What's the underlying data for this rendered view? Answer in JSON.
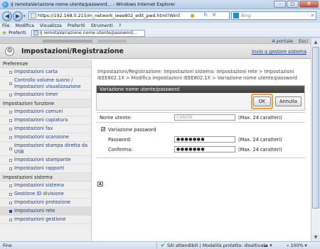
{
  "window": {
    "title": "IJ remotaVariazione nome utente/password… - Windows Internet Explorer",
    "btn_min": "–",
    "btn_max": "□",
    "btn_close": "X"
  },
  "addressbar": {
    "back": "◀",
    "forward": "▶",
    "dropdown": "▾",
    "url": "https://192.168.0.215/m_network_ieee802_edit_pwd.html?Win50=1&lk",
    "lock": "▣",
    "refresh": "↻",
    "stop": "✕",
    "search_placeholder": "Bing",
    "search_btn": "⌕"
  },
  "menubar": [
    "File",
    "Modifica",
    "Visualizza",
    "Preferiti",
    "Strumenti",
    "?"
  ],
  "favbar": {
    "favorites": "Preferiti",
    "tab_title": "IJ remotaVariazione nome utente/password…"
  },
  "page": {
    "top_links": [
      "A portale",
      "Esci"
    ],
    "title": "Impostazioni/Registrazione",
    "home_link": "Invio a gestore sistema",
    "breadcrumb": "Impostazioni/Registrazione: Impostazioni sistema: Impostazioni rete > Impostazioni IEEE802.1X > Modifica impostazioni IEEE802.1X > Variazione nome utente/password",
    "panel_title": "Variazione nome utente/password",
    "ok": "OK",
    "cancel": "Annulla",
    "username_label": "Nome utente:",
    "username_value": "CANON",
    "hint_max24": "(Max. 24 caratteri)",
    "change_pw_check": "✔",
    "change_pw_label": "Variazione password",
    "password_label": "Password:",
    "password_value": "●●●●●●●",
    "confirm_label": "Conferma:",
    "confirm_value": "●●●●●●●",
    "top_icon": "▲"
  },
  "sidebar": {
    "sec_preferenze": "Preferenze",
    "sec_funzione": "Impostazioni funzione",
    "sec_sistema": "Impostazioni sistema",
    "items": [
      "Impostazioni carta",
      "Controllo volume suono / Impostazioni visualizzazione",
      "Impostazioni timer",
      "Impostazioni comuni",
      "Impostazioni copiatura",
      "Impostazioni fax",
      "Impostazioni scansione",
      "Impostazioni stampa diretta da USB",
      "Impostazioni stampante",
      "Impostazioni rapporti",
      "Impostazioni sistema",
      "Gestione ID divisione",
      "Impostazioni protezione",
      "Impostazioni rete",
      "Impostazioni gestione"
    ]
  },
  "statusbar": {
    "done": "Fine",
    "zone": "Siti attendibili | Modalità protetta: disattivata",
    "zone_icon": "✔",
    "icons": "☁ ▾",
    "zoom": "⌕ 100% ▾"
  },
  "scrollbar": {
    "up": "▲",
    "down": "▼"
  }
}
